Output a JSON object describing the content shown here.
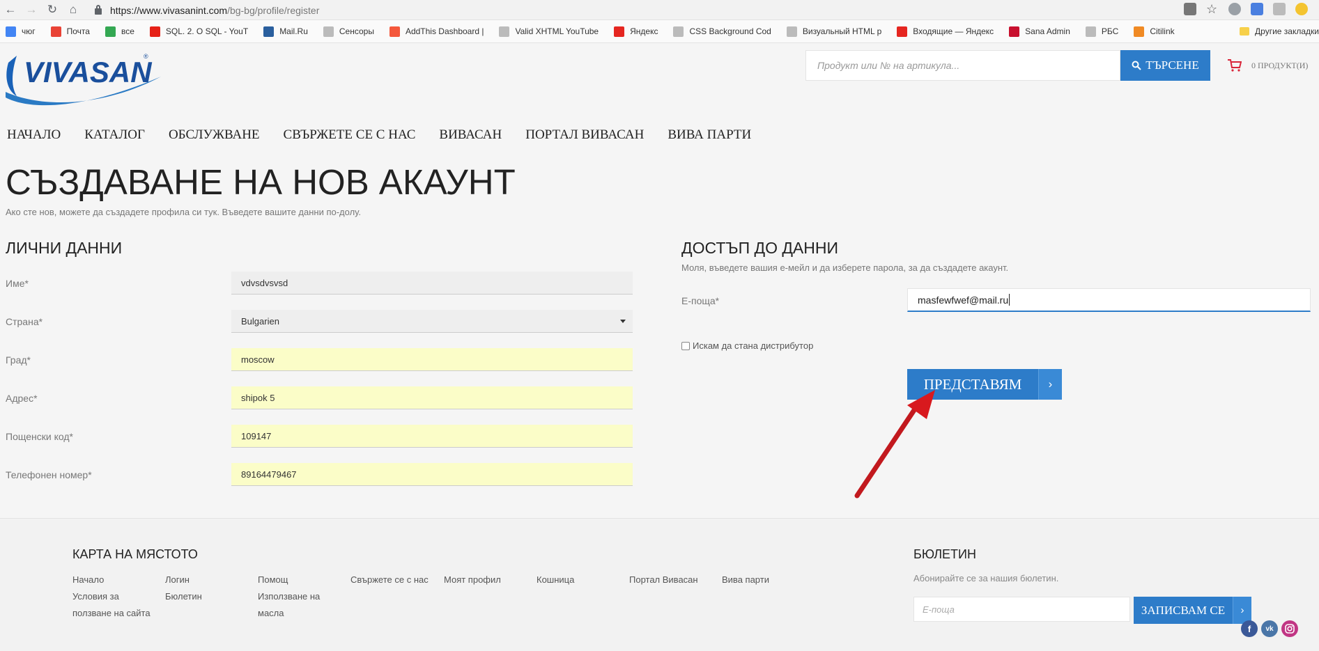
{
  "browser": {
    "url_host": "https://www.vivasanint.com",
    "url_path": "/bg-bg/profile/register",
    "bookmarks": [
      {
        "label": "чюг",
        "color": "#4285f4"
      },
      {
        "label": "Почта",
        "color": "#e94235"
      },
      {
        "label": "все",
        "color": "#34a853"
      },
      {
        "label": "SQL. 2. O SQL - YouT",
        "color": "#e62117"
      },
      {
        "label": "Mail.Ru",
        "color": "#2a5f9e"
      },
      {
        "label": "Сенсоры",
        "color": "#bbbbbb"
      },
      {
        "label": "AddThis Dashboard |",
        "color": "#f4573b"
      },
      {
        "label": "Valid XHTML YouTube",
        "color": "#bbbbbb"
      },
      {
        "label": "Яндекс",
        "color": "#e52620"
      },
      {
        "label": "CSS Background Cod",
        "color": "#bbbbbb"
      },
      {
        "label": "Визуальный HTML р",
        "color": "#bbbbbb"
      },
      {
        "label": "Входящие — Яндекс",
        "color": "#e52620"
      },
      {
        "label": "Sana Admin",
        "color": "#c8102e"
      },
      {
        "label": "РБС",
        "color": "#bbbbbb"
      },
      {
        "label": "Citilink",
        "color": "#f08a24"
      }
    ],
    "other_bookmarks": "Другие закладки"
  },
  "header": {
    "logo_text": "VIVASAN",
    "search_placeholder": "Продукт или № на артикула...",
    "search_button": "ТЪРСЕНЕ",
    "cart_label": "0 ПРОДУКТ(И)"
  },
  "nav": [
    "НАЧАЛО",
    "КАТАЛОГ",
    "ОБСЛУЖВАНЕ",
    "СВЪРЖЕТЕ СЕ С НАС",
    "ВИВАСАН",
    "ПОРТАЛ ВИВАСАН",
    "ВИВА ПАРТИ"
  ],
  "page": {
    "title": "СЪЗДАВАНЕ НА НОВ АКАУНТ",
    "subtitle": "Ако сте нов, можете да създадете профила си тук. Въведете вашите данни по-долу."
  },
  "personal": {
    "title": "ЛИЧНИ ДАННИ",
    "fields": [
      {
        "label": "Име*",
        "value": "vdvsdvsvsd"
      },
      {
        "label": "Страна*",
        "value": "Bulgarien"
      },
      {
        "label": "Град*",
        "value": "moscow"
      },
      {
        "label": "Адрес*",
        "value": "shipok 5"
      },
      {
        "label": "Пощенски код*",
        "value": "109147"
      },
      {
        "label": "Телефонен номер*",
        "value": "89164479467"
      }
    ]
  },
  "access": {
    "title": "ДОСТЪП ДО ДАННИ",
    "desc": "Моля, въведете вашия е-мейл и да изберете парола, за да създадете акаунт.",
    "email_label": "Е-поща*",
    "email_value": "masfewfwef@mail.ru",
    "distributor_label": "Искам да стана дистрибутор",
    "submit_label": "ПРЕДСТАВЯМ",
    "chevron": "›"
  },
  "footer": {
    "sitemap_title": "КАРТА НА МЯСТОТО",
    "links": {
      "home": "Начало",
      "terms1": "Условия за",
      "terms2": "ползване на сайта",
      "login": "Логин",
      "newsletter": "Бюлетин",
      "help": "Помощ",
      "oils1": "Използване на",
      "oils2": "масла",
      "contact": "Свържете се с нас",
      "profile": "Моят профил",
      "cart": "Кошница",
      "portal": "Портал Вивасан",
      "party": "Вива парти"
    },
    "newsletter_title": "БЮЛЕТИН",
    "newsletter_desc": "Абонирайте се за нашия бюлетин.",
    "newsletter_placeholder": "Е-поща",
    "subscribe_label": "ЗАПИСВАМ СЕ",
    "chevron": "›",
    "social": {
      "facebook": "f",
      "vk": "vk"
    }
  },
  "colors": {
    "accent": "#2d7cc9",
    "autofill": "#fbfdc8"
  }
}
